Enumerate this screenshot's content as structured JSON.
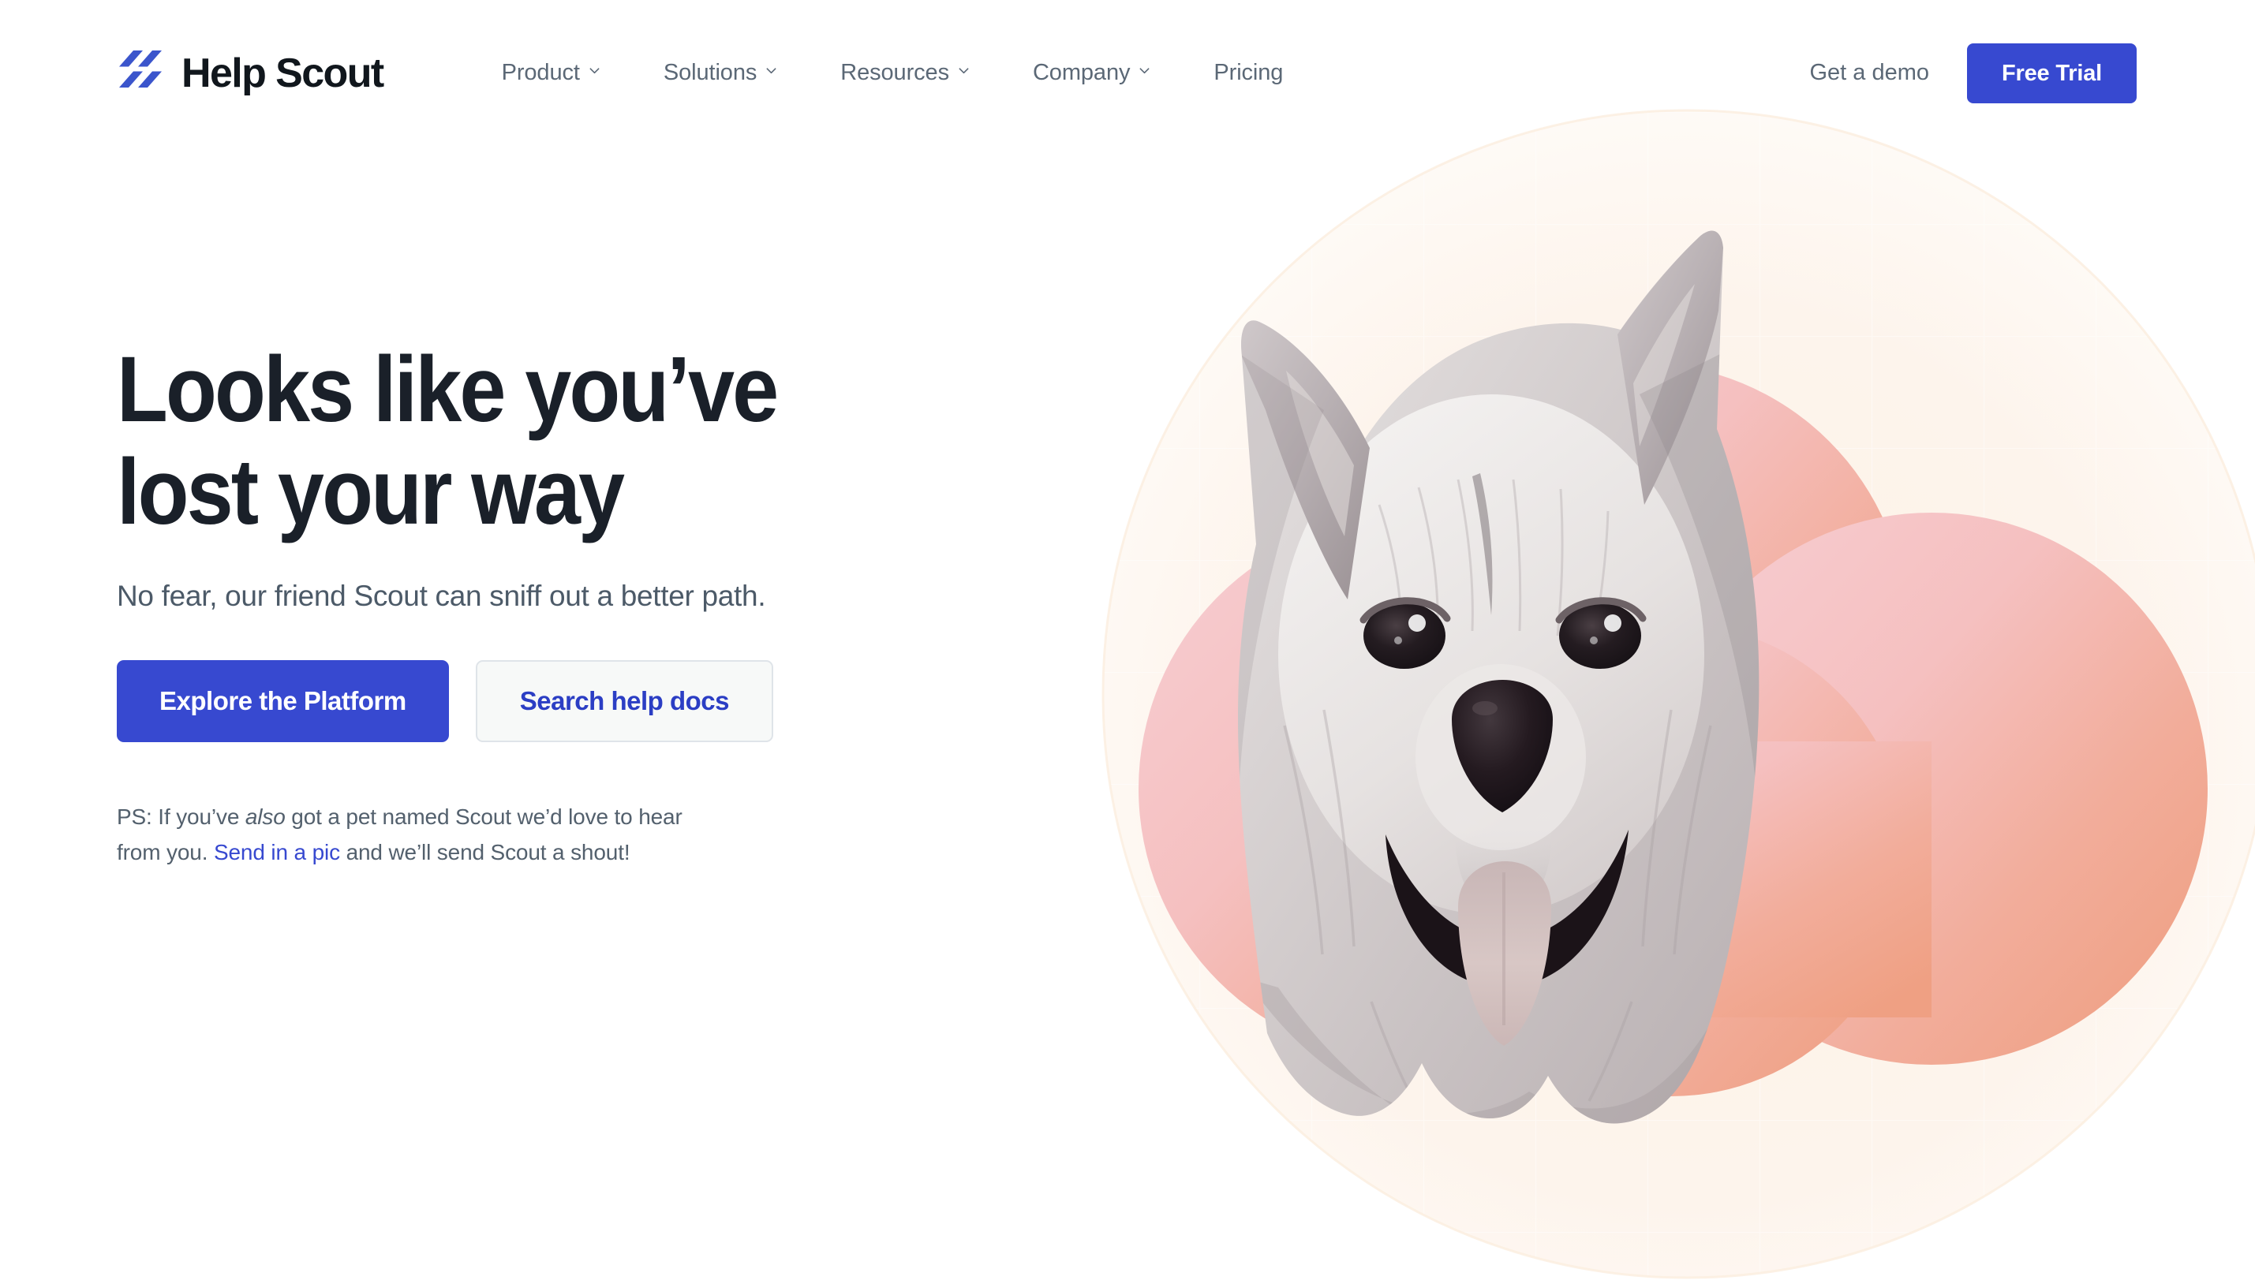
{
  "brand": {
    "name": "Help Scout",
    "logo_icon": "help-scout-slashes-logo",
    "logo_color": "#3b55cc"
  },
  "nav": {
    "items": [
      {
        "label": "Product",
        "has_dropdown": true,
        "icon": "chevron-down-icon"
      },
      {
        "label": "Solutions",
        "has_dropdown": true,
        "icon": "chevron-down-icon"
      },
      {
        "label": "Resources",
        "has_dropdown": true,
        "icon": "chevron-down-icon"
      },
      {
        "label": "Company",
        "has_dropdown": true,
        "icon": "chevron-down-icon"
      },
      {
        "label": "Pricing",
        "has_dropdown": false,
        "icon": ""
      }
    ]
  },
  "header_actions": {
    "demo_label": "Get a demo",
    "trial_label": "Free Trial",
    "trial_color": "#3749d0"
  },
  "hero": {
    "headline": "Looks like you’ve\nlost your way",
    "subhead": "No fear, our friend Scout can sniff out a better path.",
    "primary_cta": "Explore the Platform",
    "secondary_cta": "Search help docs",
    "ps": {
      "before_italic": "PS: If you’ve ",
      "italic": "also",
      "after_italic": " got a pet named Scout we’d love to hear from you. ",
      "link": "Send in a pic",
      "after_link": " and we’ll send Scout a shout!"
    }
  },
  "artwork": {
    "name": "scout-dog-photo-with-gradient-blob",
    "blob_color_start": "#f6c9ce",
    "blob_color_end": "#f0a287",
    "backdrop_color": "#fdf4ec",
    "dog_icon": "dog-portrait-illustration"
  },
  "colors": {
    "page_background": "#ffffff",
    "headline": "#1a2029",
    "body_text": "#4c5a68",
    "nav_text": "#5b6876",
    "accent_blue": "#3749d0"
  }
}
